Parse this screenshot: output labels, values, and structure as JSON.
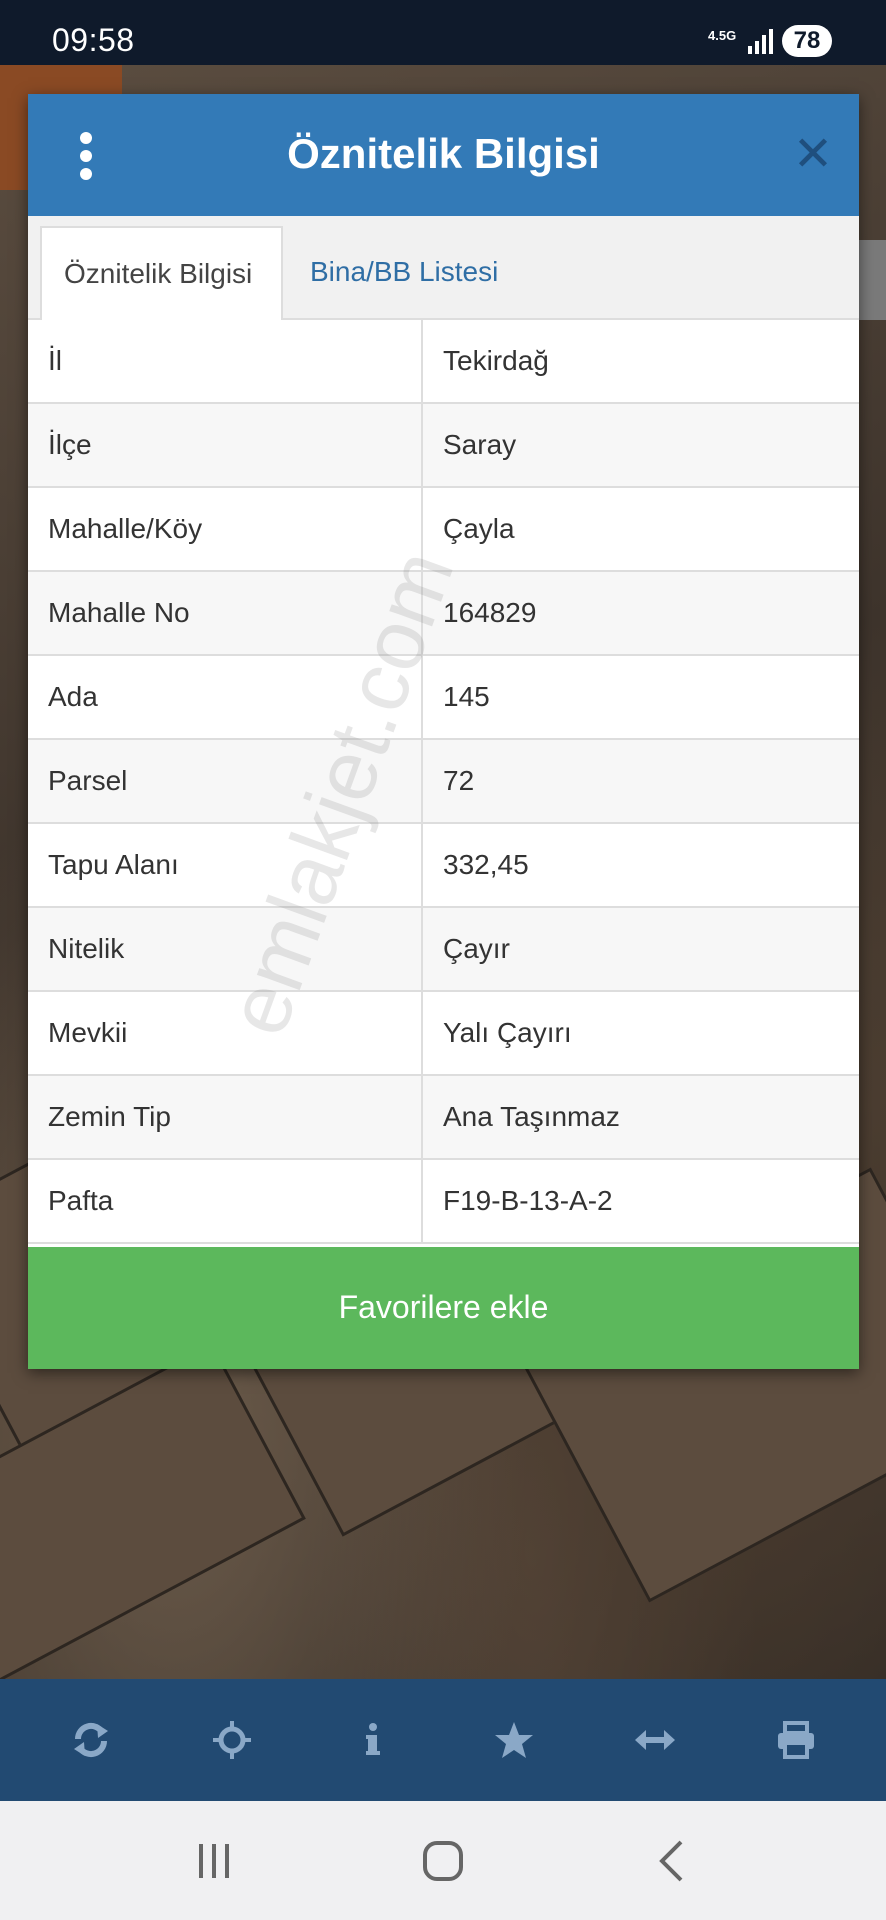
{
  "status_bar": {
    "time": "09:58",
    "network": "4.5G",
    "battery": "78"
  },
  "dialog": {
    "title": "Öznitelik Bilgisi",
    "tabs": [
      {
        "label": "Öznitelik Bilgisi",
        "active": true
      },
      {
        "label": "Bina/BB Listesi",
        "active": false
      }
    ],
    "rows": [
      {
        "key": "İl",
        "value": "Tekirdağ"
      },
      {
        "key": "İlçe",
        "value": "Saray"
      },
      {
        "key": "Mahalle/Köy",
        "value": "Çayla"
      },
      {
        "key": "Mahalle No",
        "value": "164829"
      },
      {
        "key": "Ada",
        "value": "145"
      },
      {
        "key": "Parsel",
        "value": "72"
      },
      {
        "key": "Tapu Alanı",
        "value": "332,45"
      },
      {
        "key": "Nitelik",
        "value": "Çayır"
      },
      {
        "key": "Mevkii",
        "value": "Yalı Çayırı"
      },
      {
        "key": "Zemin Tip",
        "value": "Ana Taşınmaz"
      },
      {
        "key": "Pafta",
        "value": "F19-B-13-A-2"
      }
    ],
    "favorites_button": "Favorilere ekle"
  },
  "watermark": "emlakjet.com",
  "toolbar": {
    "icons": [
      "refresh-icon",
      "locate-icon",
      "info-icon",
      "star-icon",
      "measure-icon",
      "print-icon"
    ]
  },
  "nav_bar": {
    "icons": [
      "recent-apps-icon",
      "home-icon",
      "back-icon"
    ]
  },
  "colors": {
    "header": "#337ab7",
    "favorites": "#5cb85c",
    "toolbar": "#224a72",
    "status_bar": "#0f1a2b"
  }
}
